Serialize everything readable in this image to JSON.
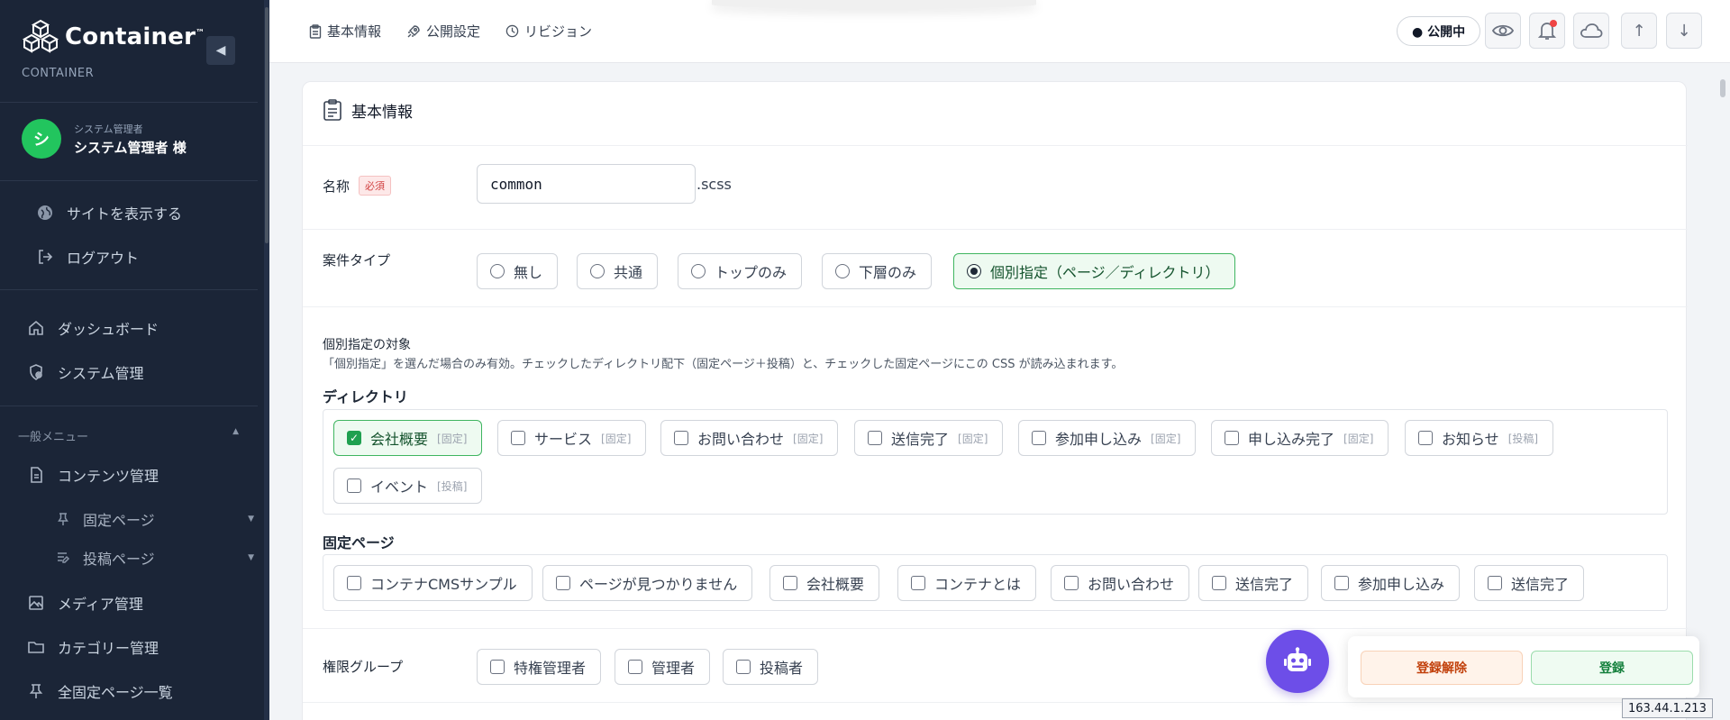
{
  "sidebar": {
    "brand": "Container",
    "brand_tm": "™",
    "brand_sub": "CONTAINER",
    "collapse_icon": "◀",
    "user": {
      "avatar_letter": "シ",
      "role": "システム管理者",
      "name": "システム管理者 様"
    },
    "links": [
      {
        "label": "サイトを表示する",
        "icon": "globe-icon"
      },
      {
        "label": "ログアウト",
        "icon": "logout-icon"
      }
    ],
    "main_items": [
      {
        "label": "ダッシュボード",
        "icon": "home-icon"
      },
      {
        "label": "システム管理",
        "icon": "shield-gear-icon"
      }
    ],
    "section_label": "一般メニュー",
    "section_caret": "▲",
    "menu": {
      "contents": "コンテンツ管理",
      "fixed_pages": "固定ページ",
      "posts": "投稿ページ",
      "media": "メディア管理",
      "category": "カテゴリー管理",
      "all_fixed": "全固定ページ一覧",
      "caret": "▼"
    }
  },
  "topbar": {
    "nav": [
      {
        "label": "基本情報",
        "icon": "clipboard-icon"
      },
      {
        "label": "公開設定",
        "icon": "rocket-icon"
      },
      {
        "label": "リビジョン",
        "icon": "clock-icon"
      }
    ],
    "status": "● 公開中",
    "arrow_up": "↑",
    "arrow_down": "↓"
  },
  "card": {
    "title": "基本情報",
    "name_label": "名称",
    "required": "必須",
    "name_value": "common",
    "extension": ".scss",
    "type_label": "案件タイプ",
    "type_options": [
      {
        "label": "無し",
        "selected": false
      },
      {
        "label": "共通",
        "selected": false
      },
      {
        "label": "トップのみ",
        "selected": false
      },
      {
        "label": "下層のみ",
        "selected": false
      },
      {
        "label": "個別指定（ページ／ディレクトリ）",
        "selected": true
      }
    ],
    "target_title": "個別指定の対象",
    "target_desc": "「個別指定」を選んだ場合のみ有効。チェックしたディレクトリ配下（固定ページ＋投稿）と、チェックした固定ページにこの CSS が読み込まれます。",
    "directory_title": "ディレクトリ",
    "directories": [
      {
        "label": "会社概要",
        "tag": "[固定]",
        "checked": true
      },
      {
        "label": "サービス",
        "tag": "[固定]",
        "checked": false
      },
      {
        "label": "お問い合わせ",
        "tag": "[固定]",
        "checked": false
      },
      {
        "label": "送信完了",
        "tag": "[固定]",
        "checked": false
      },
      {
        "label": "参加申し込み",
        "tag": "[固定]",
        "checked": false
      },
      {
        "label": "申し込み完了",
        "tag": "[固定]",
        "checked": false
      },
      {
        "label": "お知らせ",
        "tag": "[投稿]",
        "checked": false
      },
      {
        "label": "イベント",
        "tag": "[投稿]",
        "checked": false
      }
    ],
    "fixed_title": "固定ページ",
    "fixed_pages": [
      {
        "label": "コンテナCMSサンプル"
      },
      {
        "label": "ページが見つかりません"
      },
      {
        "label": "会社概要"
      },
      {
        "label": "コンテナとは"
      },
      {
        "label": "お問い合わせ"
      },
      {
        "label": "送信完了"
      },
      {
        "label": "参加申し込み"
      },
      {
        "label": "送信完了"
      }
    ],
    "perm_label": "権限グループ",
    "perm_options": [
      {
        "label": "特権管理者"
      },
      {
        "label": "管理者"
      },
      {
        "label": "投稿者"
      }
    ]
  },
  "actions": {
    "unregister": "登録解除",
    "register": "登録"
  },
  "ip": "163.44.1.213",
  "colors": {
    "sidebar_bg": "#1b2537",
    "accent_green": "#1fa050",
    "bot_purple": "#6d4ee8"
  }
}
